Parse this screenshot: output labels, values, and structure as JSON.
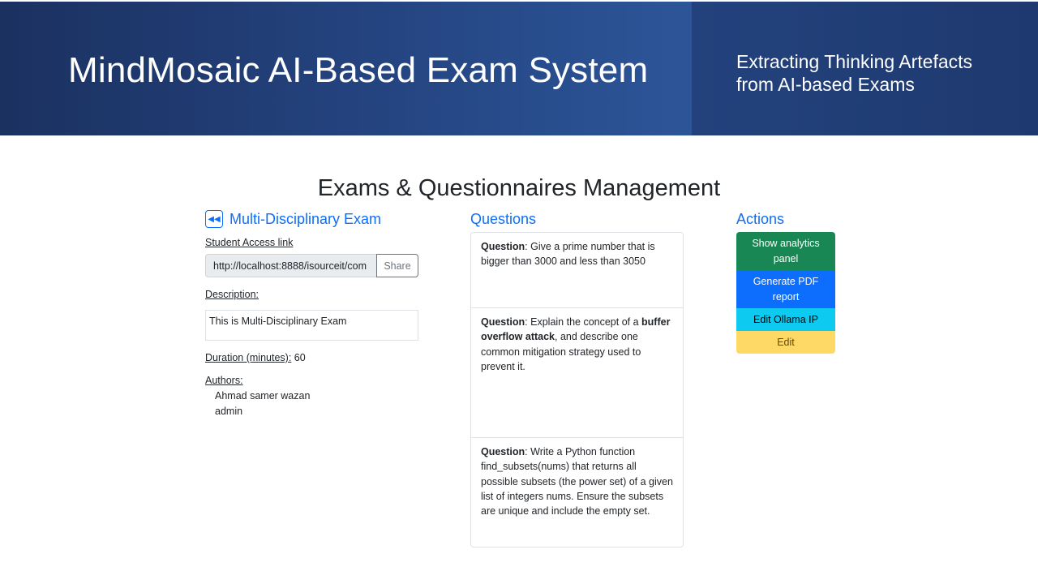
{
  "banner": {
    "title": "MindMosaic AI-Based Exam System",
    "subtitle": "Extracting Thinking Artefacts from AI-based Exams"
  },
  "page_title": "Exams & Questionnaires Management",
  "exam": {
    "back_icon": "rewind-icon",
    "name": "Multi-Disciplinary Exam",
    "access_link_label": "Student Access link",
    "access_link_value": "http://localhost:8888/isourceit/com",
    "share_label": "Share",
    "description_label": "Description:",
    "description": "This is Multi-Disciplinary Exam",
    "duration_label": "Duration (minutes):",
    "duration_value": "60",
    "authors_label": "Authors:",
    "authors": [
      "Ahmad samer wazan",
      "admin"
    ]
  },
  "questions": {
    "heading": "Questions",
    "prefix": "Question",
    "items": [
      {
        "parts": [
          {
            "t": "Give a prime number that is bigger than 3000 and less than 3050",
            "b": false
          }
        ]
      },
      {
        "parts": [
          {
            "t": "Explain the concept of a ",
            "b": false
          },
          {
            "t": "buffer overflow attack",
            "b": true
          },
          {
            "t": ", and describe one common mitigation strategy used to prevent it.",
            "b": false
          }
        ]
      },
      {
        "parts": [
          {
            "t": "Write a Python function find_subsets(nums) that returns all possible subsets (the power set) of a given list of integers nums. Ensure the subsets are unique and include the empty set.",
            "b": false
          }
        ]
      }
    ]
  },
  "actions": {
    "heading": "Actions",
    "buttons": [
      {
        "label": "Show analytics panel",
        "color": "#198754"
      },
      {
        "label": "Generate PDF report",
        "color": "#0d6efd"
      },
      {
        "label": "Edit Ollama IP",
        "color": "#0dcaf0"
      },
      {
        "label": "Edit",
        "color": "#ffd966"
      }
    ]
  }
}
